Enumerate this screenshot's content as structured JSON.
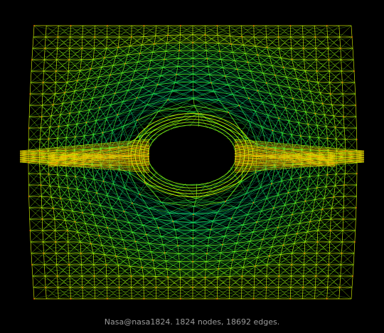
{
  "caption": "Nasa@nasa1824. 1824 nodes, 18692 edges.",
  "colors": {
    "background": "#000000",
    "edge_colormap": [
      "#1e3cff",
      "#00a0c8",
      "#00d28c",
      "#3cff28",
      "#c8ff00",
      "#ffd200",
      "#ff3c00"
    ],
    "caption_text": "#9a9a9a"
  }
}
